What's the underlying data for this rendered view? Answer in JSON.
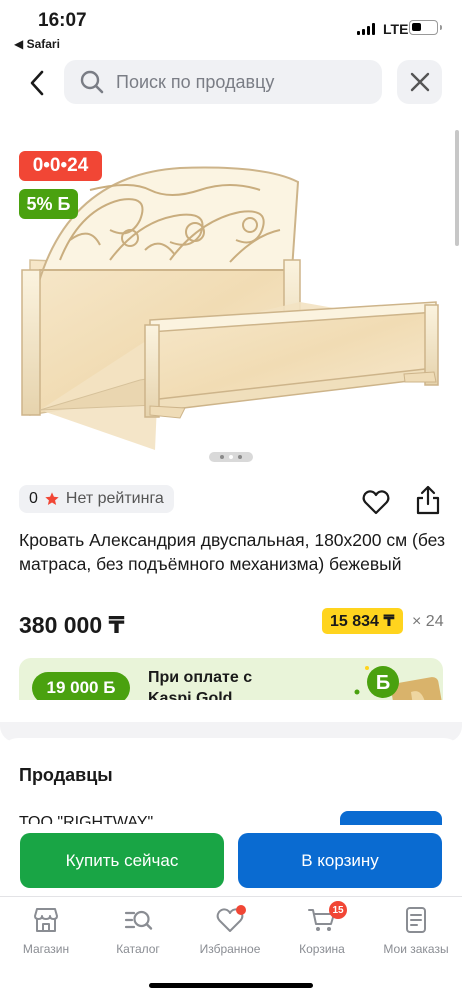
{
  "status_bar": {
    "time": "16:07",
    "back_app": "◀ Safari",
    "network": "LTE"
  },
  "header": {
    "search_placeholder": "Поиск по продавцу"
  },
  "product": {
    "badge_installment": "0•0•24",
    "badge_bonus": "5% Б",
    "image_dots": {
      "count": 3,
      "active_index": 1
    },
    "rating_count": "0",
    "rating_label": "Нет рейтинга",
    "title": "Кровать Александрия двуспальная, 180х200 см (без матраса, без подъёмного механизма) бежевый",
    "price": "380 000 ₸",
    "monthly_payment": "15 834 ₸",
    "months": "× 24"
  },
  "kaspi_gold": {
    "bonus": "19 000 Б",
    "text": "При оплате с Kaspi Gold"
  },
  "sellers": {
    "title": "Продавцы",
    "first_seller": "ТОО \"RIGHTWAY\""
  },
  "actions": {
    "buy_now": "Купить сейчас",
    "add_to_cart": "В корзину"
  },
  "tabbar": {
    "items": [
      {
        "label": "Магазин",
        "icon": "store-icon"
      },
      {
        "label": "Каталог",
        "icon": "catalog-icon"
      },
      {
        "label": "Избранное",
        "icon": "heart-icon",
        "dot": true
      },
      {
        "label": "Корзина",
        "icon": "cart-icon",
        "badge": "15"
      },
      {
        "label": "Мои заказы",
        "icon": "orders-icon"
      }
    ]
  },
  "colors": {
    "installment_red": "#f14635",
    "bonus_green": "#4aa10f",
    "buy_green": "#19a545",
    "kaspi_blue": "#0a6bd1",
    "price_yellow": "#ffd41e"
  }
}
